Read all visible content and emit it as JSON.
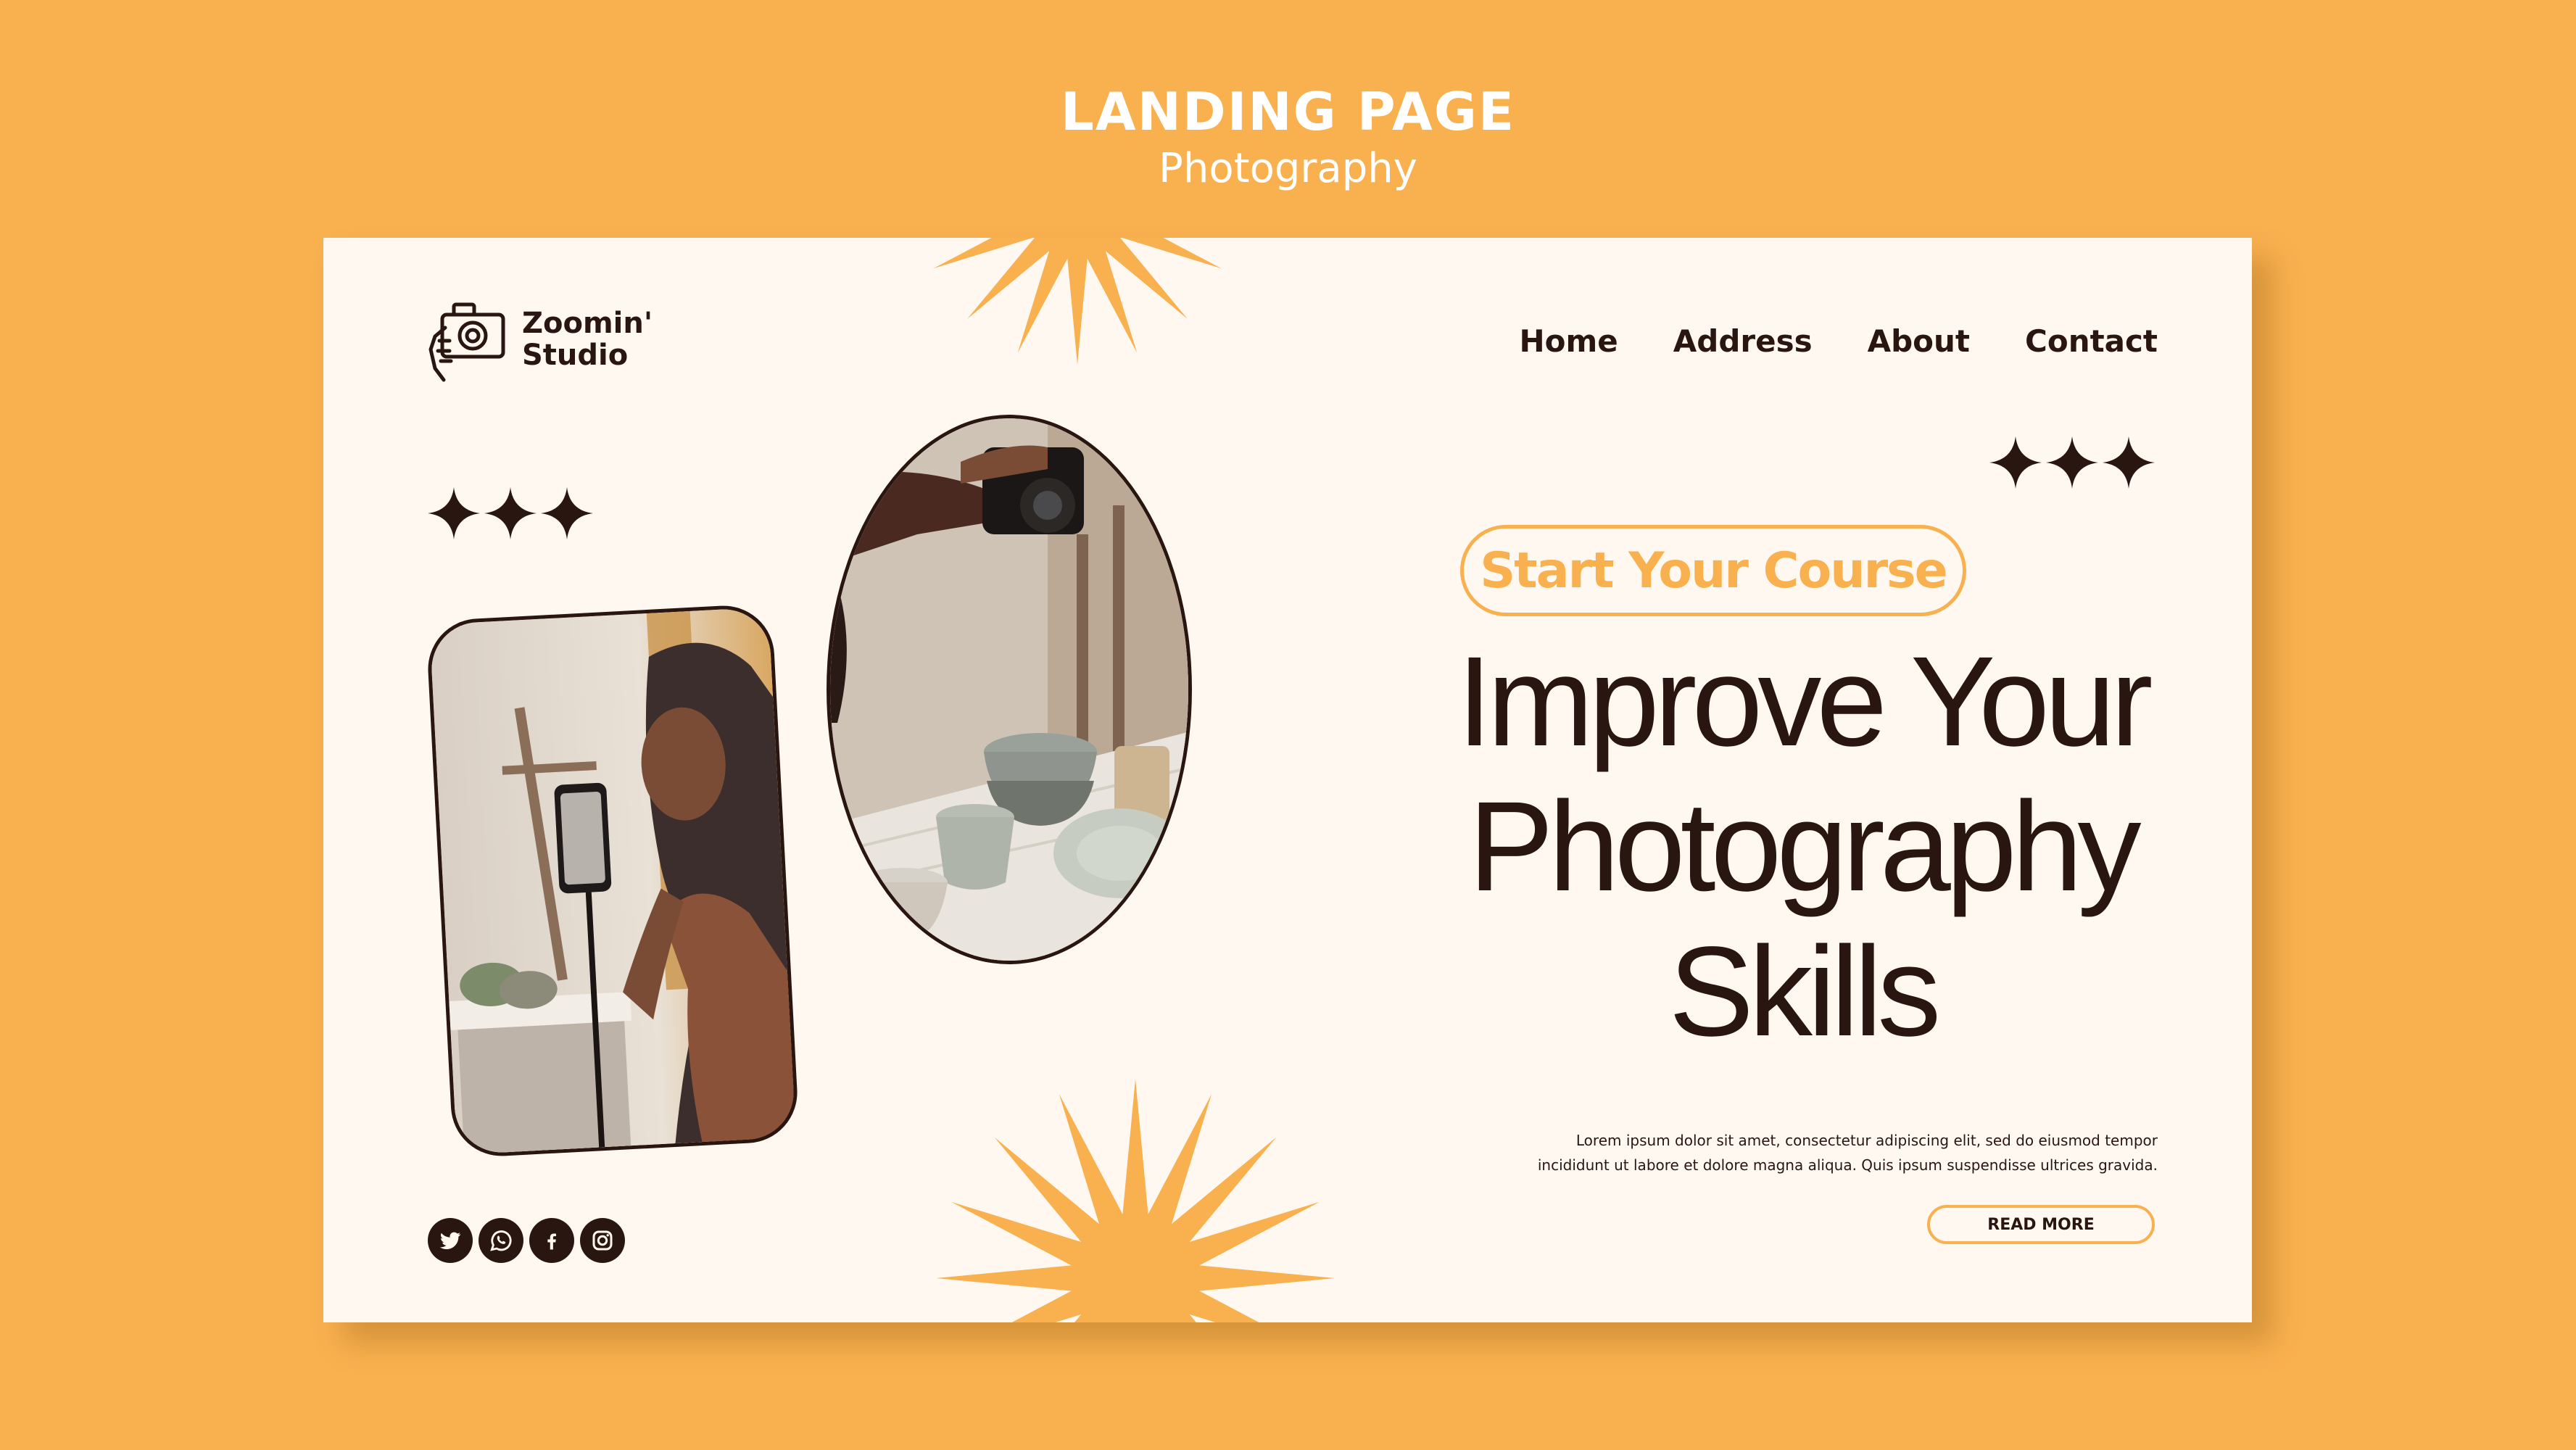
{
  "header": {
    "title": "LANDING PAGE",
    "subtitle": "Photography"
  },
  "brand": {
    "name_line1": "Zoomin'",
    "name_line2": "Studio",
    "logo_icon": "camera-hand-icon"
  },
  "nav": {
    "items": [
      "Home",
      "Address",
      "About",
      "Contact"
    ]
  },
  "hero": {
    "course_button": "Start Your Course",
    "headline_line1": "Improve Your",
    "headline_line2": "Photography",
    "headline_line3": "Skills",
    "body_line1": "Lorem ipsum dolor sit amet, consectetur adipiscing elit, sed do eiusmod tempor",
    "body_line2": "incididunt ut labore et dolore magna aliqua. Quis ipsum suspendisse ultrices gravida.",
    "read_more": "READ MORE"
  },
  "social": {
    "icons": [
      "twitter-icon",
      "whatsapp-icon",
      "facebook-icon",
      "instagram-icon"
    ]
  },
  "colors": {
    "background": "#F9B04F",
    "card": "#FEF8F1",
    "text_dark": "#2A1610",
    "accent": "#F9B04F"
  }
}
